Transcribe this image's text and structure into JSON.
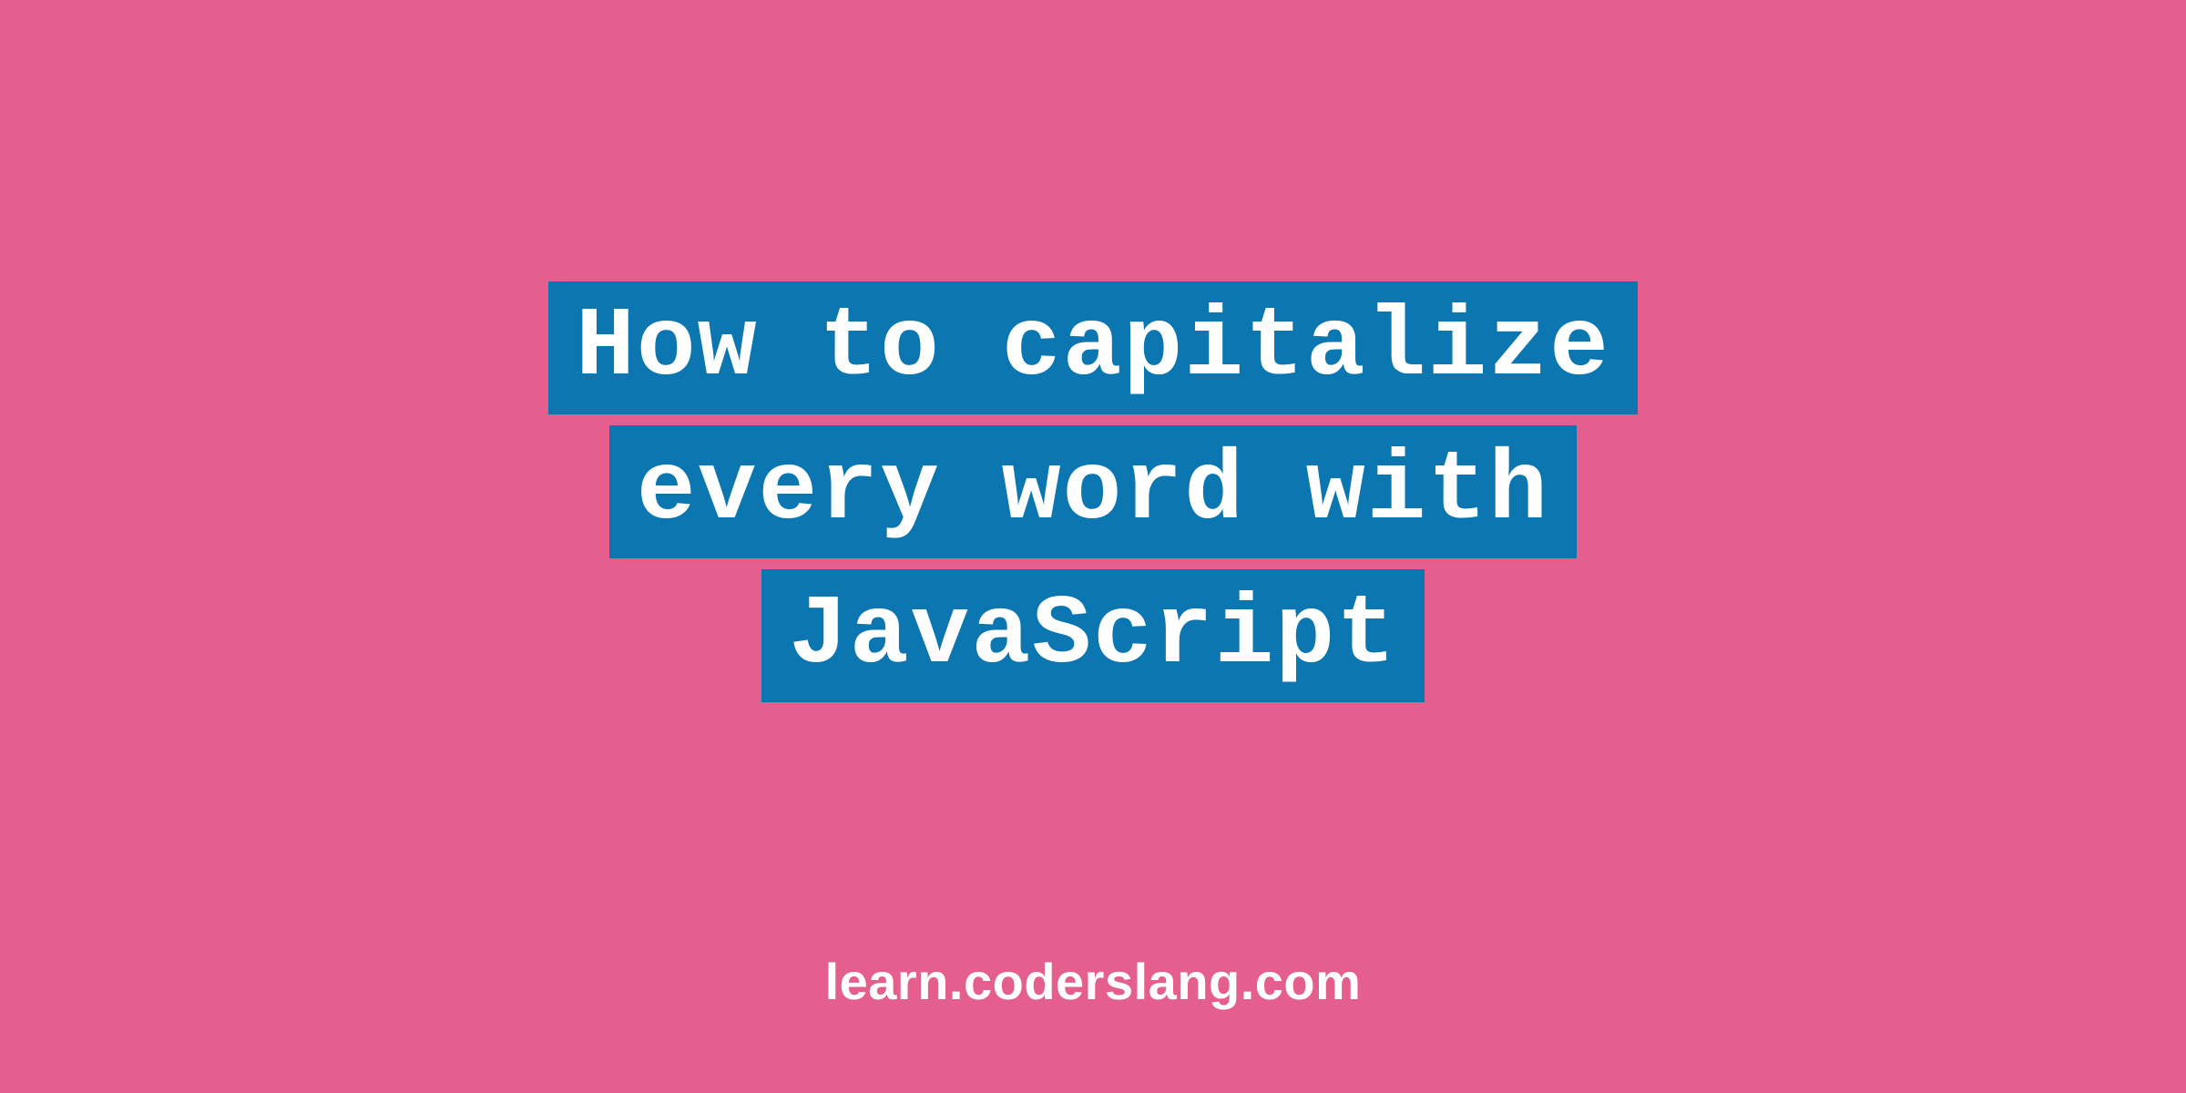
{
  "title": {
    "line1": "How to capitalize",
    "line2": "every word with",
    "line3": "JavaScript"
  },
  "footer": {
    "url": "learn.coderslang.com"
  },
  "colors": {
    "background": "#e55f8e",
    "highlight": "#0c76b0",
    "text": "#ffffff"
  }
}
